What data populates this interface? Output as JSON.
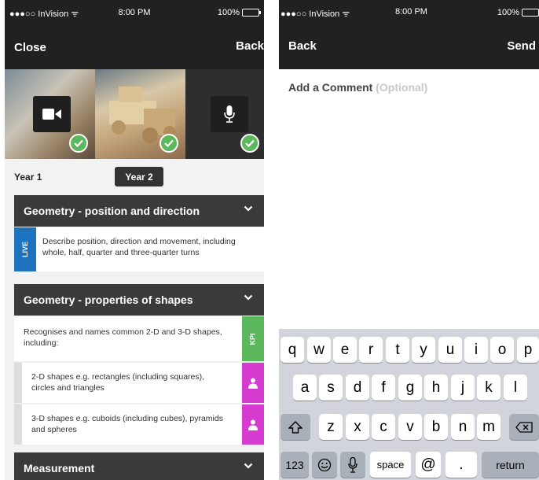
{
  "status_bar": {
    "carrier": "●●●○○ InVision ᯤ",
    "time": "8:00 PM",
    "battery": "100%"
  },
  "left_screen": {
    "nav": {
      "close_label": "Close",
      "back_label": "Back"
    },
    "media": [
      {
        "icon": "video-camera-icon",
        "checked": true
      },
      {
        "icon": "none",
        "checked": true
      },
      {
        "icon": "microphone-icon",
        "checked": true
      }
    ],
    "year_tabs": [
      {
        "label": "Year 1",
        "selected": false
      },
      {
        "label": "Year 2",
        "selected": true
      }
    ],
    "cards": [
      {
        "title": "Geometry - position and direction",
        "rows": [
          {
            "tag": "LIVE",
            "text": "Describe position, direction and movement, including whole, half, quarter and three-quarter turns"
          }
        ]
      },
      {
        "title": "Geometry - properties of shapes",
        "rows": [
          {
            "tag": "KPI",
            "text": "Recognises and names common 2-D and 3-D shapes, including:"
          },
          {
            "tag": "person-icon",
            "text": "2-D shapes e.g. rectangles (including squares), circles and triangles"
          },
          {
            "tag": "person-icon",
            "text": "3-D shapes e.g. cuboids (including cubes), pyramids and spheres"
          }
        ]
      },
      {
        "title": "Measurement",
        "rows": []
      }
    ],
    "colors": {
      "live": "#1e73be",
      "kpi": "#5cb85c",
      "person": "#d63bd0",
      "check": "#5cb85c"
    }
  },
  "right_screen": {
    "nav": {
      "back_label": "Back",
      "send_label": "Send"
    },
    "comment_label": "Add a Comment",
    "comment_optional": "(Optional)",
    "keyboard": {
      "row1": [
        "q",
        "w",
        "e",
        "r",
        "t",
        "y",
        "u",
        "i",
        "o",
        "p"
      ],
      "row2": [
        "a",
        "s",
        "d",
        "f",
        "g",
        "h",
        "j",
        "k",
        "l"
      ],
      "row3": [
        "z",
        "x",
        "c",
        "v",
        "b",
        "n",
        "m"
      ],
      "numbers_label": "123",
      "space_label": "space",
      "at_label": "@",
      "dot_label": ".",
      "return_label": "return"
    }
  }
}
